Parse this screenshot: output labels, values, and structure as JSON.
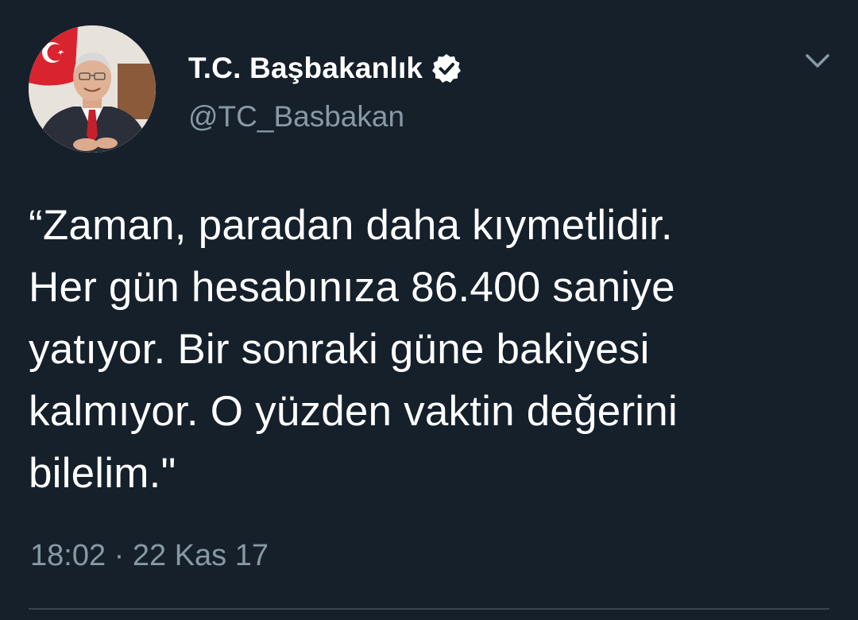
{
  "tweet": {
    "author": {
      "display_name": "T.C. Başbakanlık",
      "handle": "@TC_Basbakan",
      "verified": true,
      "avatar_icon": "profile-photo"
    },
    "text": "“Zaman, paradan daha kıymetlidir.\nHer gün hesabınıza 86.400 saniye\nyatıyor. Bir sonraki güne bakiyesi\nkalmıyor. O yüzden vaktin değerini\nbilelim.\"",
    "timestamp": {
      "time": "18:02",
      "separator": "·",
      "date": "22 Kas 17"
    },
    "menu_icon": "chevron-down-icon"
  },
  "colors": {
    "background": "#15202b",
    "text_primary": "#ffffff",
    "text_secondary": "#8899a6",
    "divider": "#38444d"
  }
}
